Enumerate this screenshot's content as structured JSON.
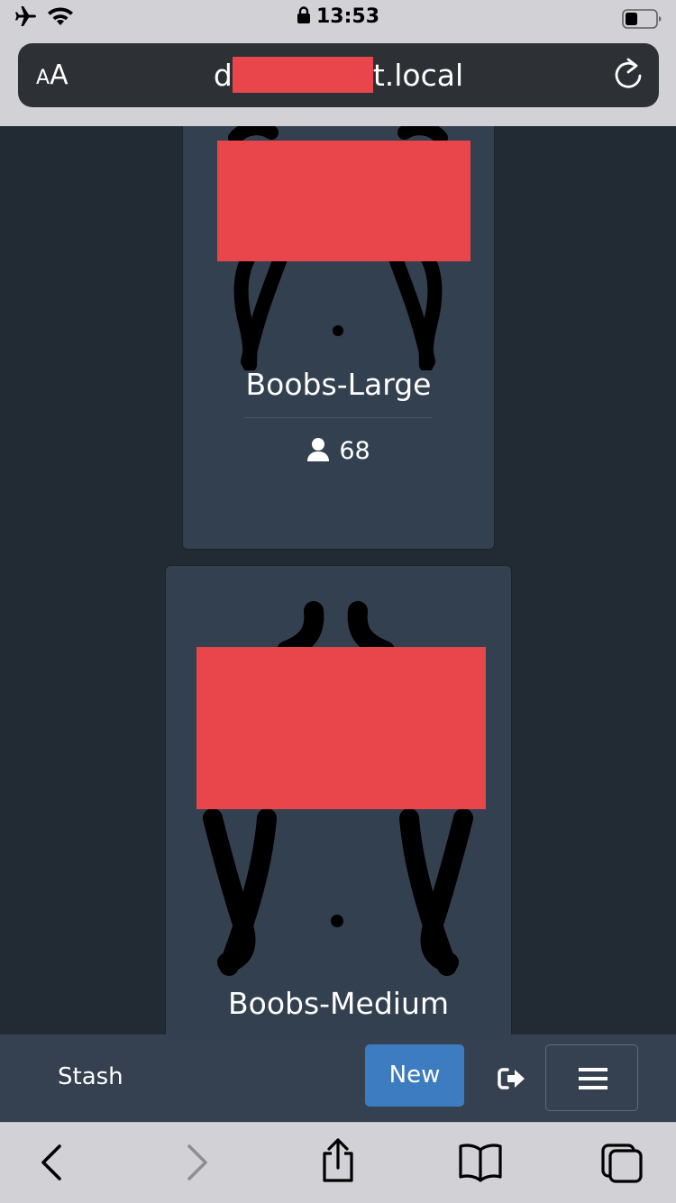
{
  "status_bar": {
    "time": "13:53"
  },
  "browser": {
    "text_size_label_small": "A",
    "text_size_label_large": "A",
    "url_prefix": "d",
    "url_suffix": "t.local"
  },
  "cards": [
    {
      "title": "Boobs-Large",
      "performer_count": "68"
    },
    {
      "title": "Boobs-Medium"
    }
  ],
  "navbar": {
    "brand": "Stash",
    "new_label": "New"
  },
  "colors": {
    "page_bg": "#222b34",
    "card_bg": "#334050",
    "navbar_bg": "#354150",
    "primary_button": "#3d7cc0",
    "redaction": "#e8464b",
    "browser_chrome": "#d1d1d6"
  },
  "icons": {
    "status": [
      "airplane-icon",
      "wifi-icon",
      "lock-icon",
      "battery-icon"
    ],
    "browser": [
      "reload-icon"
    ],
    "navbar": [
      "sign-out-icon",
      "hamburger-menu-icon",
      "user-icon"
    ],
    "toolbar": [
      "back-icon",
      "forward-icon",
      "share-icon",
      "bookmarks-icon",
      "tabs-icon"
    ]
  }
}
